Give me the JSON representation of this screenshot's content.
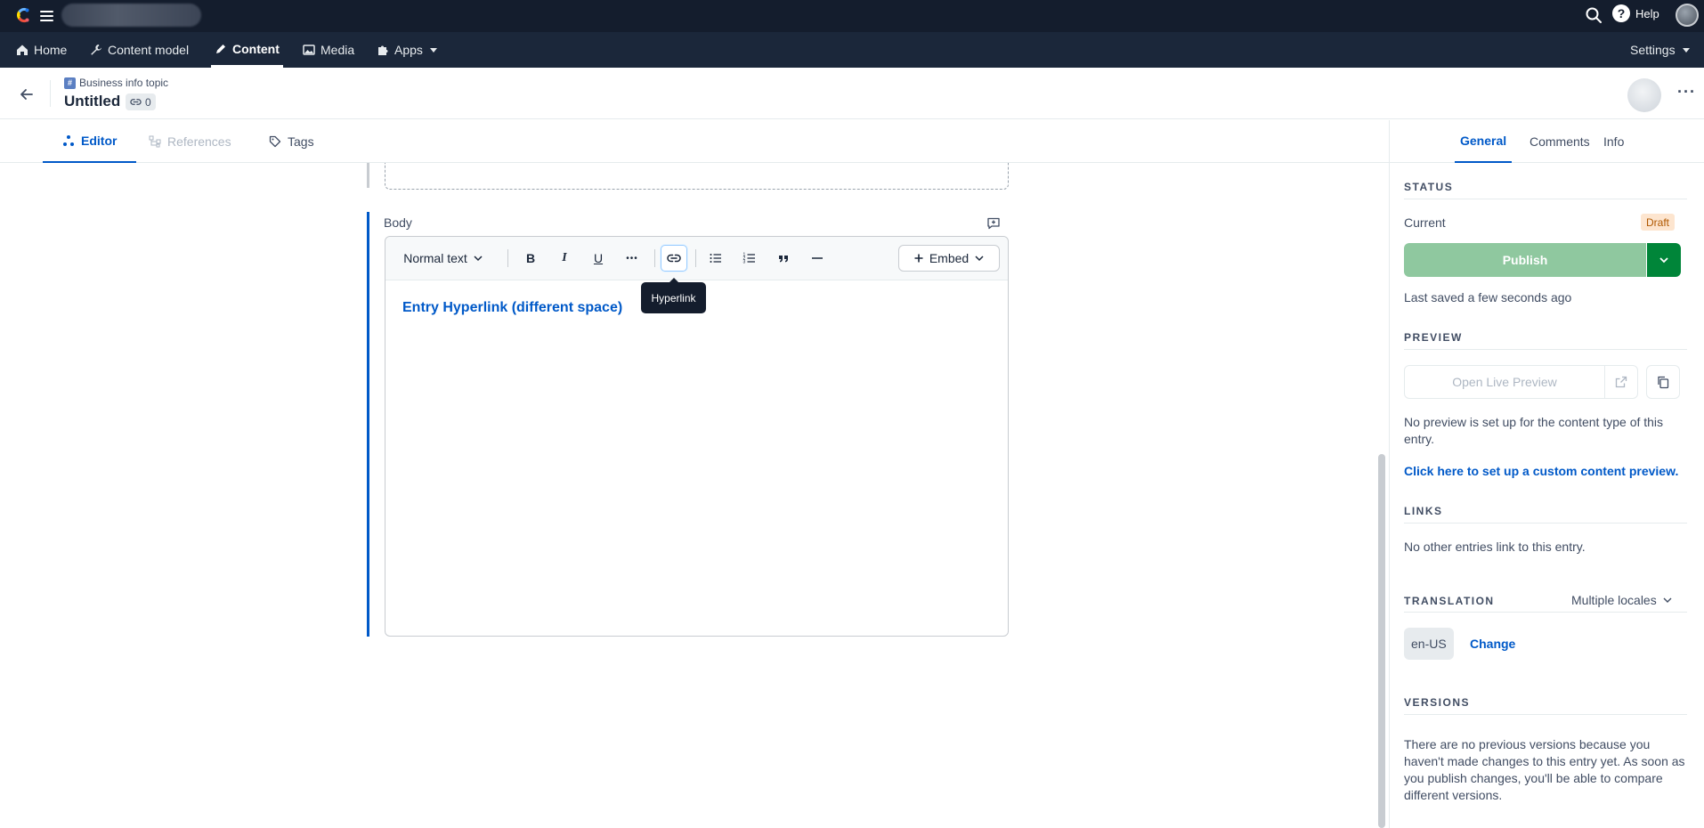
{
  "topbar": {
    "help_label": "Help",
    "icons": [
      "contentful-logo",
      "hamburger-icon",
      "search-icon",
      "help-icon"
    ]
  },
  "nav": {
    "items": [
      {
        "label": "Home",
        "icon": "home-icon"
      },
      {
        "label": "Content model",
        "icon": "wrench-icon"
      },
      {
        "label": "Content",
        "icon": "pen-icon",
        "active": true
      },
      {
        "label": "Media",
        "icon": "image-icon"
      },
      {
        "label": "Apps",
        "icon": "puzzle-icon"
      }
    ],
    "settings_label": "Settings"
  },
  "entry": {
    "content_type": "Business info topic",
    "content_type_icon": "#",
    "title": "Untitled",
    "reference_count": "0"
  },
  "editor_tabs": [
    {
      "label": "Editor",
      "icon": "editor-icon",
      "active": true
    },
    {
      "label": "References",
      "icon": "references-icon",
      "disabled": true
    },
    {
      "label": "Tags",
      "icon": "tag-icon"
    }
  ],
  "body_field": {
    "label": "Body",
    "toolbar": {
      "text_style": "Normal text",
      "bold": "B",
      "italic": "I",
      "underline": "U",
      "more": "•••",
      "embed_label": "Embed",
      "tooltip": "Hyperlink"
    },
    "content_link": "Entry Hyperlink (different space)"
  },
  "sidebar": {
    "tabs": [
      {
        "label": "General",
        "active": true
      },
      {
        "label": "Comments"
      },
      {
        "label": "Info"
      }
    ],
    "status": {
      "heading": "STATUS",
      "current_label": "Current",
      "badge": "Draft",
      "publish_label": "Publish",
      "last_saved": "Last saved a few seconds ago"
    },
    "preview": {
      "heading": "PREVIEW",
      "button_label": "Open Live Preview",
      "message": "No preview is set up for the content type of this entry.",
      "setup_link": "Click here to set up a custom content preview."
    },
    "links": {
      "heading": "LINKS",
      "message": "No other entries link to this entry."
    },
    "translation": {
      "heading": "TRANSLATION",
      "select_value": "Multiple locales",
      "locale": "en-US",
      "change_label": "Change"
    },
    "versions": {
      "heading": "VERSIONS",
      "message": "There are no previous versions because you haven't made changes to this entry yet. As soon as you publish changes, you'll be able to compare different versions."
    }
  },
  "colors": {
    "accent": "#0059c8",
    "topbar": "#141d2d",
    "navbar": "#1b273a",
    "publish_disabled": "#8fc89f",
    "publish_dark": "#008539",
    "draft_badge_bg": "#fde5cf"
  }
}
